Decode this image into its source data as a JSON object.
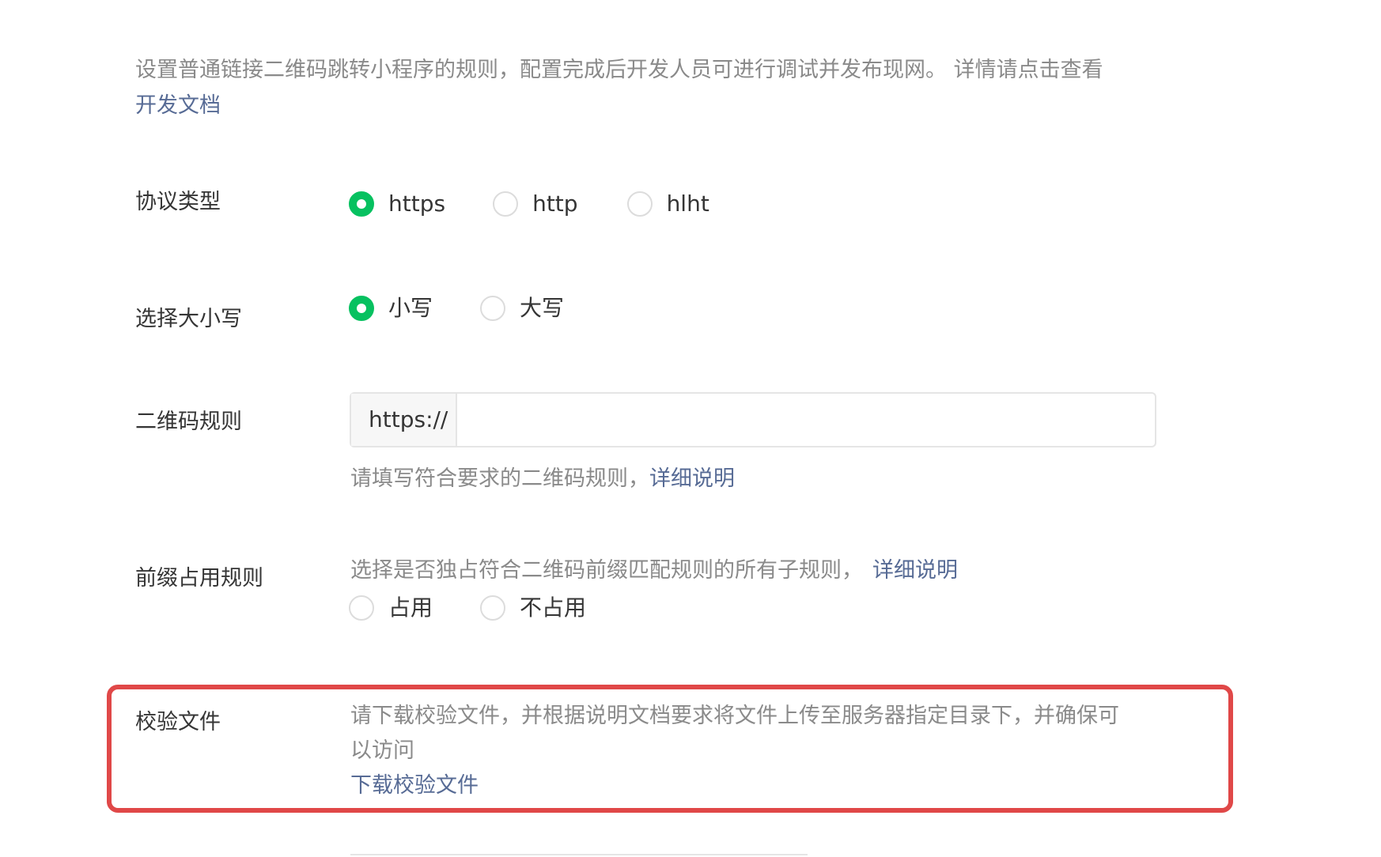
{
  "intro": {
    "text": "设置普通链接二维码跳转小程序的规则，配置完成后开发人员可进行调试并发布现网。 详情请点击查看",
    "link": "开发文档"
  },
  "protocol": {
    "label": "协议类型",
    "options": [
      "https",
      "http",
      "hlht"
    ],
    "selected": "https"
  },
  "case": {
    "label": "选择大小写",
    "options": [
      "小写",
      "大写"
    ],
    "selected": "小写"
  },
  "qr_rule": {
    "label": "二维码规则",
    "prefix": "https://",
    "value": "",
    "hint": "请填写符合要求的二维码规则，",
    "hint_link": "详细说明"
  },
  "prefix_rule": {
    "label": "前缀占用规则",
    "hint": "选择是否独占符合二维码前缀匹配规则的所有子规则，",
    "hint_link": "详细说明",
    "options": [
      "占用",
      "不占用"
    ],
    "selected": ""
  },
  "verify_file": {
    "label": "校验文件",
    "description_line1": "请下载校验文件，并根据说明文档要求将文件上传至服务器指定目录下，并确保可",
    "description_line2": "以访问",
    "download_link": "下载校验文件"
  },
  "colors": {
    "accent_green": "#07c160",
    "link_blue": "#576b95",
    "highlight_red": "#e04848"
  }
}
